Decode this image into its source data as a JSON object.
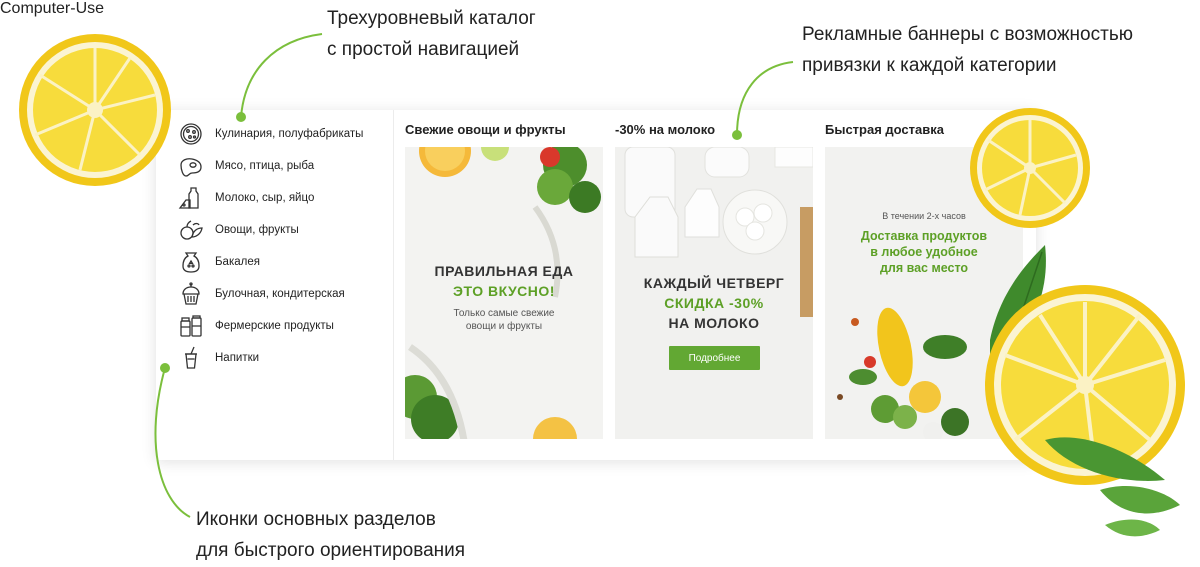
{
  "callouts": {
    "catalog": {
      "line1": "Трехуровневый каталог",
      "line2": "с простой навигацией"
    },
    "banners": {
      "line1": "Рекламные баннеры с возможностью",
      "line2": "привязки к каждой категории"
    },
    "icons": {
      "line1": "Иконки основных разделов",
      "line2": "для быстрого ориентирования"
    }
  },
  "sidebar": {
    "items": [
      {
        "label": "Кулинария, полуфабрикаты",
        "icon": "pizza-icon"
      },
      {
        "label": "Мясо, птица, рыба",
        "icon": "steak-icon"
      },
      {
        "label": "Молоко, сыр, яйцо",
        "icon": "milk-cheese-icon"
      },
      {
        "label": "Овощи, фрукты",
        "icon": "vegetables-icon"
      },
      {
        "label": "Бакалея",
        "icon": "flour-sack-icon"
      },
      {
        "label": "Булочная, кондитерская",
        "icon": "cupcake-icon"
      },
      {
        "label": "Фермерские продукты",
        "icon": "farm-jars-icon"
      },
      {
        "label": "Напитки",
        "icon": "drink-cup-icon"
      }
    ]
  },
  "promos": [
    {
      "title": "Свежие овощи и фрукты",
      "banner": {
        "line1": "ПРАВИЛЬНАЯ ЕДА",
        "line2": "ЭТО ВКУСНО!",
        "sub1": "Только самые свежие",
        "sub2": "овощи и фрукты"
      }
    },
    {
      "title": "-30% на молоко",
      "banner": {
        "line1": "КАЖДЫЙ ЧЕТВЕРГ",
        "line2": "СКИДКА -30%",
        "line3": "НА МОЛОКО",
        "button": "Подробнее"
      }
    },
    {
      "title": "Быстрая доставка",
      "banner": {
        "pre": "В течении 2-х часов",
        "line1": "Доставка продуктов",
        "line2": "в любое удобное",
        "line3": "для вас место"
      }
    }
  ],
  "colors": {
    "accent_green": "#62a833",
    "headline_green": "#5da026",
    "callout_line": "#7bbf3c",
    "lemon": "#f6d21e"
  }
}
